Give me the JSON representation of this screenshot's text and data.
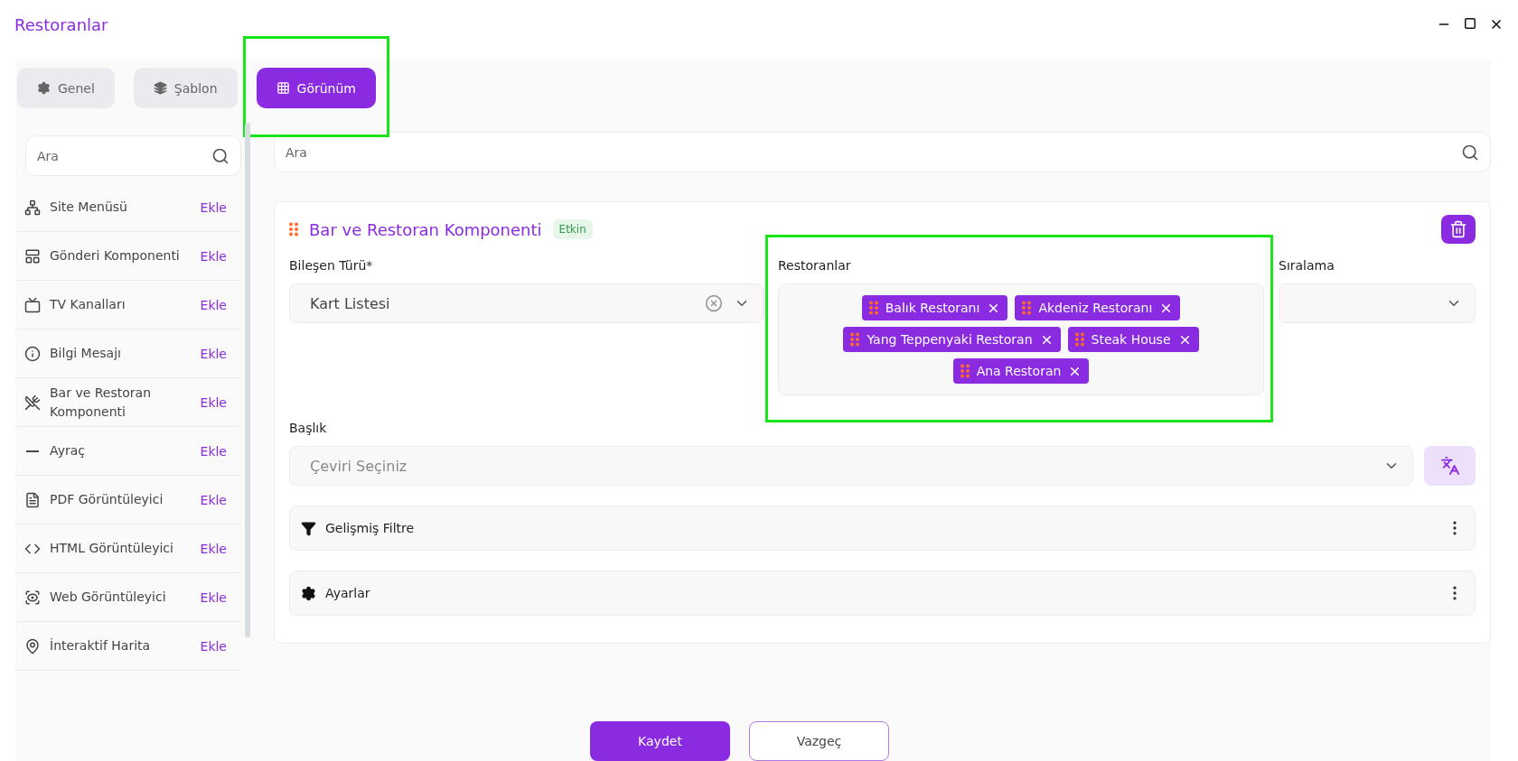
{
  "window": {
    "title": "Restoranlar"
  },
  "tabs": [
    {
      "label": "Genel",
      "selected": false,
      "highlighted": false
    },
    {
      "label": "Şablon",
      "selected": false,
      "highlighted": false
    },
    {
      "label": "Görünüm",
      "selected": true,
      "highlighted": true
    }
  ],
  "sidebar": {
    "search": {
      "placeholder": "Ara"
    },
    "items": [
      {
        "label": "Site Menüsü",
        "action": "Ekle"
      },
      {
        "label": "Gönderi Komponenti",
        "action": "Ekle"
      },
      {
        "label": "TV Kanalları",
        "action": "Ekle"
      },
      {
        "label": "Bilgi Mesajı",
        "action": "Ekle"
      },
      {
        "label": "Bar ve Restoran Komponenti",
        "action": "Ekle"
      },
      {
        "label": "Ayraç",
        "action": "Ekle"
      },
      {
        "label": "PDF Görüntüleyici",
        "action": "Ekle"
      },
      {
        "label": "HTML Görüntüleyici",
        "action": "Ekle"
      },
      {
        "label": "Web Görüntüleyici",
        "action": "Ekle"
      },
      {
        "label": "İnteraktif Harita",
        "action": "Ekle"
      }
    ]
  },
  "main": {
    "search": {
      "placeholder": "Ara"
    },
    "component": {
      "title": "Bar ve Restoran Komponenti",
      "status": "Etkin",
      "type_field": {
        "label": "Bileşen Türü*",
        "value": "Kart Listesi"
      },
      "restaurants": {
        "label": "Restoranlar",
        "highlighted": true,
        "tags": [
          "Balık Restoranı",
          "Akdeniz Restoranı",
          "Yang Teppenyaki Restoran",
          "Steak House",
          "Ana Restoran"
        ]
      },
      "sort_field": {
        "label": "Sıralama"
      },
      "heading": {
        "label": "Başlık",
        "placeholder": "Çeviri Seçiniz"
      },
      "panels": [
        {
          "label": "Gelişmiş Filtre"
        },
        {
          "label": "Ayarlar"
        }
      ]
    }
  },
  "buttons": [
    {
      "label": "Kaydet",
      "kind": "primary"
    },
    {
      "label": "Vazgeç",
      "kind": "secondary"
    }
  ]
}
